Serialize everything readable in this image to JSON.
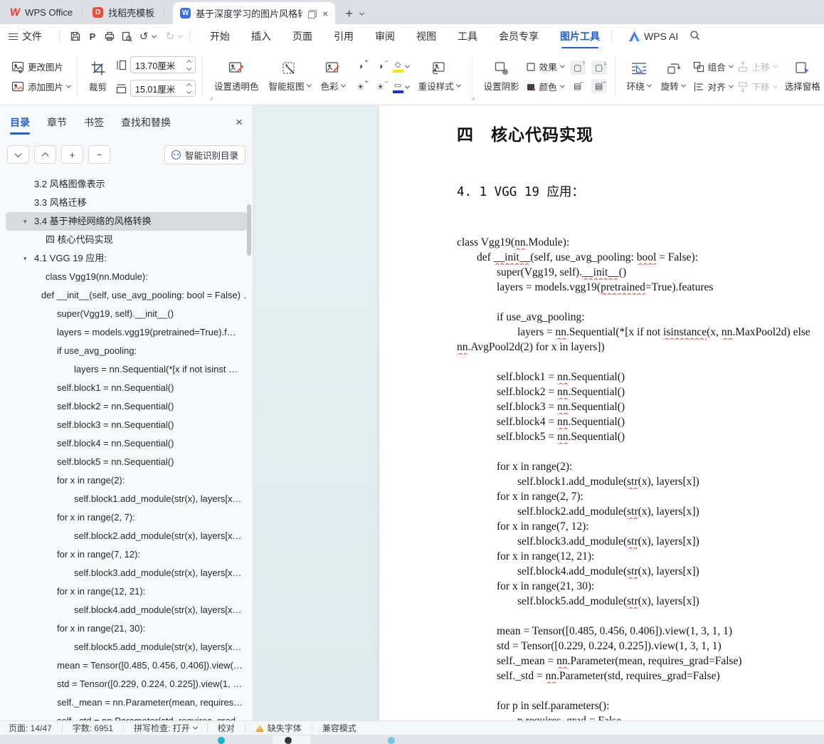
{
  "tabbar": {
    "tabs": [
      {
        "label": "WPS Office"
      },
      {
        "label": "找稻壳模板"
      },
      {
        "label": "基于深度学习的图片风格转换",
        "active": true
      }
    ]
  },
  "menubar": {
    "file": "文件",
    "items": [
      "开始",
      "插入",
      "页面",
      "引用",
      "审阅",
      "视图",
      "工具",
      "会员专享"
    ],
    "active_item": "图片工具",
    "ai_label": "WPS AI"
  },
  "icons": {
    "undo": "↺",
    "redo": "↻",
    "close": "×",
    "pdf": "P",
    "plus": "+",
    "minus": "−",
    "toc_arrow": "▾",
    "launcher": "⌟"
  },
  "ribbon": {
    "change_picture": "更改图片",
    "add_picture": "添加图片",
    "crop": "裁剪",
    "height_value": "13.70厘米",
    "width_value": "15.01厘米",
    "set_transparent": "设置透明色",
    "smart_cutout": "智能抠图",
    "color_adjust": "色彩",
    "reset_style": "重设样式",
    "set_shadow": "设置阴影",
    "effects": "效果",
    "picture_color": "颜色",
    "wrap": "环绕",
    "rotate": "旋转",
    "group": "组合",
    "align": "对齐",
    "move_up": "上移",
    "move_down": "下移",
    "selection_pane": "选择窗格",
    "accent_yellow": "#ffe400",
    "accent_blue": "#1a32e0",
    "accent_orange": "#e8622d"
  },
  "sidebar": {
    "tabs": [
      "目录",
      "章节",
      "书签",
      "查找和替换"
    ],
    "active_tab": "目录",
    "smart_toc": "智能识别目录",
    "items": [
      {
        "t": "3.2 风格图像表示",
        "pad": 48
      },
      {
        "t": "3.3 风格迁移",
        "pad": 48
      },
      {
        "t": "3.4 基于神经网络的风格转换",
        "pad": 48,
        "arrow": true,
        "sel": true
      },
      {
        "t": "四 核心代码实现",
        "pad": 64
      },
      {
        "t": "4.1 VGG 19 应用:",
        "pad": 48,
        "arrow": true
      },
      {
        "t": "class Vgg19(nn.Module):",
        "pad": 64
      },
      {
        "t": "def __init__(self, use_avg_pooling: bool = False) …",
        "pad": 58
      },
      {
        "t": "super(Vgg19, self).__init__()",
        "pad": 80
      },
      {
        "t": "layers = models.vgg19(pretrained=True).f…",
        "pad": 80
      },
      {
        "t": "if use_avg_pooling:",
        "pad": 80
      },
      {
        "t": "layers = nn.Sequential(*[x if not isinst …",
        "pad": 104
      },
      {
        "t": "self.block1 = nn.Sequential()",
        "pad": 80
      },
      {
        "t": "self.block2 = nn.Sequential()",
        "pad": 80
      },
      {
        "t": "self.block3 = nn.Sequential()",
        "pad": 80
      },
      {
        "t": "self.block4 = nn.Sequential()",
        "pad": 80
      },
      {
        "t": "self.block5 = nn.Sequential()",
        "pad": 80
      },
      {
        "t": "for x in range(2):",
        "pad": 80
      },
      {
        "t": "self.block1.add_module(str(x), layers[x…",
        "pad": 104
      },
      {
        "t": "for x in range(2, 7):",
        "pad": 80
      },
      {
        "t": "self.block2.add_module(str(x), layers[x…",
        "pad": 104
      },
      {
        "t": "for x in range(7, 12):",
        "pad": 80
      },
      {
        "t": "self.block3.add_module(str(x), layers[x…",
        "pad": 104
      },
      {
        "t": "for x in range(12, 21):",
        "pad": 80
      },
      {
        "t": "self.block4.add_module(str(x), layers[x…",
        "pad": 104
      },
      {
        "t": "for x in range(21, 30):",
        "pad": 80
      },
      {
        "t": "self.block5.add_module(str(x), layers[x…",
        "pad": 104
      },
      {
        "t": "mean = Tensor([0.485, 0.456, 0.406]).view(…",
        "pad": 80
      },
      {
        "t": "std = Tensor([0.229, 0.224, 0.225]).view(1, …",
        "pad": 80
      },
      {
        "t": "self._mean = nn.Parameter(mean, requires…",
        "pad": 80
      },
      {
        "t": "self._std = nn.Parameter(std, requires_grad…",
        "pad": 80
      }
    ]
  },
  "document": {
    "heading": "四　核心代码实现",
    "subheading": "4. 1 VGG 19 应用：",
    "code_lines": [
      {
        "ind": 0,
        "segs": [
          [
            "class Vgg19(",
            0
          ],
          [
            "nn",
            1
          ],
          [
            ".Module):",
            0
          ]
        ]
      },
      {
        "ind": 1,
        "segs": [
          [
            "def ",
            0
          ],
          [
            "__init__",
            1
          ],
          [
            "(self, use_avg_pooling: ",
            0
          ],
          [
            "bool",
            1
          ],
          [
            " = False):",
            0
          ]
        ]
      },
      {
        "ind": 2,
        "segs": [
          [
            "super(Vgg19, self).",
            0
          ],
          [
            "__init__",
            1
          ],
          [
            "()",
            0
          ]
        ]
      },
      {
        "ind": 2,
        "segs": [
          [
            "layers = models.vgg19(",
            0
          ],
          [
            "pretrained",
            1
          ],
          [
            "=True).features",
            0
          ]
        ]
      },
      {
        "ind": 0,
        "segs": []
      },
      {
        "ind": 2,
        "segs": [
          [
            "if use_avg_pooling:",
            0
          ]
        ]
      },
      {
        "ind": 3,
        "segs": [
          [
            "layers = ",
            0
          ],
          [
            "nn",
            1
          ],
          [
            ".Sequential(*[x if not ",
            0
          ],
          [
            "isinstance",
            1
          ],
          [
            "(x, ",
            0
          ],
          [
            "nn",
            1
          ],
          [
            ".MaxPool2d) else",
            0
          ]
        ]
      },
      {
        "ind": 0,
        "segs": [
          [
            "nn",
            1
          ],
          [
            ".AvgPool2d(2) for x in layers])",
            0
          ]
        ]
      },
      {
        "ind": 0,
        "segs": []
      },
      {
        "ind": 2,
        "segs": [
          [
            "self.block1 = ",
            0
          ],
          [
            "nn",
            1
          ],
          [
            ".Sequential()",
            0
          ]
        ]
      },
      {
        "ind": 2,
        "segs": [
          [
            "self.block2 = ",
            0
          ],
          [
            "nn",
            1
          ],
          [
            ".Sequential()",
            0
          ]
        ]
      },
      {
        "ind": 2,
        "segs": [
          [
            "self.block3 = ",
            0
          ],
          [
            "nn",
            1
          ],
          [
            ".Sequential()",
            0
          ]
        ]
      },
      {
        "ind": 2,
        "segs": [
          [
            "self.block4 = ",
            0
          ],
          [
            "nn",
            1
          ],
          [
            ".Sequential()",
            0
          ]
        ]
      },
      {
        "ind": 2,
        "segs": [
          [
            "self.block5 = ",
            0
          ],
          [
            "nn",
            1
          ],
          [
            ".Sequential()",
            0
          ]
        ]
      },
      {
        "ind": 0,
        "segs": []
      },
      {
        "ind": 2,
        "segs": [
          [
            "for x in range(2):",
            0
          ]
        ]
      },
      {
        "ind": 3,
        "segs": [
          [
            "self.block1.add_module(",
            0
          ],
          [
            "str",
            1
          ],
          [
            "(x), layers[x])",
            0
          ]
        ]
      },
      {
        "ind": 2,
        "segs": [
          [
            "for x in range(2, 7):",
            0
          ]
        ]
      },
      {
        "ind": 3,
        "segs": [
          [
            "self.block2.add_module(",
            0
          ],
          [
            "str",
            1
          ],
          [
            "(x), layers[x])",
            0
          ]
        ]
      },
      {
        "ind": 2,
        "segs": [
          [
            "for x in range(7, 12):",
            0
          ]
        ]
      },
      {
        "ind": 3,
        "segs": [
          [
            "self.block3.add_module(",
            0
          ],
          [
            "str",
            1
          ],
          [
            "(x), layers[x])",
            0
          ]
        ]
      },
      {
        "ind": 2,
        "segs": [
          [
            "for x in range(12, 21):",
            0
          ]
        ]
      },
      {
        "ind": 3,
        "segs": [
          [
            "self.block4.add_module(",
            0
          ],
          [
            "str",
            1
          ],
          [
            "(x), layers[x])",
            0
          ]
        ]
      },
      {
        "ind": 2,
        "segs": [
          [
            "for x in range(21, 30):",
            0
          ]
        ]
      },
      {
        "ind": 3,
        "segs": [
          [
            "self.block5.add_module(",
            0
          ],
          [
            "str",
            1
          ],
          [
            "(x), layers[x])",
            0
          ]
        ]
      },
      {
        "ind": 0,
        "segs": []
      },
      {
        "ind": 2,
        "segs": [
          [
            "mean = Tensor([0.485, 0.456, 0.406]).view(1, 3, 1, 1)",
            0
          ]
        ]
      },
      {
        "ind": 2,
        "segs": [
          [
            "std = Tensor([0.229, 0.224, 0.225]).view(1, 3, 1, 1)",
            0
          ]
        ]
      },
      {
        "ind": 2,
        "segs": [
          [
            "self._mean = ",
            0
          ],
          [
            "nn",
            1
          ],
          [
            ".Parameter(mean, requires_grad=False)",
            0
          ]
        ]
      },
      {
        "ind": 2,
        "segs": [
          [
            "self._std = ",
            0
          ],
          [
            "nn",
            1
          ],
          [
            ".Parameter(std, requires_grad=False)",
            0
          ]
        ]
      },
      {
        "ind": 0,
        "segs": []
      },
      {
        "ind": 2,
        "segs": [
          [
            "for p in self.parameters():",
            0
          ]
        ]
      },
      {
        "ind": 3,
        "segs": [
          [
            "p.requires_grad = False",
            0
          ]
        ]
      }
    ]
  },
  "statusbar": {
    "page": "页面: 14/47",
    "words": "字数: 6951",
    "spellcheck": "拼写检查: 打开",
    "proofread": "校对",
    "missing_font": "缺失字体",
    "compat": "兼容模式"
  }
}
